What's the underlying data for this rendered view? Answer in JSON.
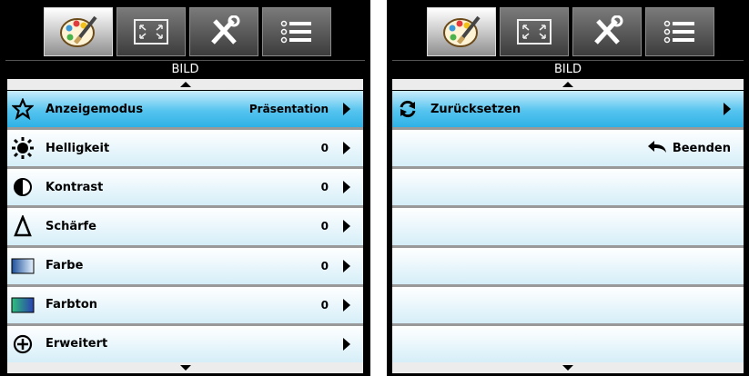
{
  "left_panel": {
    "title": "BILD",
    "rows": [
      {
        "label": "Anzeigemodus",
        "value": "Präsentation",
        "icon": "star-outline-icon",
        "selected": true
      },
      {
        "label": "Helligkeit",
        "value": "0",
        "icon": "brightness-sun-icon"
      },
      {
        "label": "Kontrast",
        "value": "0",
        "icon": "contrast-half-circle-icon"
      },
      {
        "label": "Schärfe",
        "value": "0",
        "icon": "sharpness-triangle-icon"
      },
      {
        "label": "Farbe",
        "value": "0",
        "icon": "color-gradient-icon"
      },
      {
        "label": "Farbton",
        "value": "0",
        "icon": "tint-gradient-icon"
      },
      {
        "label": "Erweitert",
        "value": "",
        "icon": "plus-circle-icon"
      }
    ]
  },
  "right_panel": {
    "title": "BILD",
    "rows": [
      {
        "label": "Zurücksetzen",
        "icon": "reset-arrows-icon",
        "selected": true
      },
      {
        "exit_label": "Beenden",
        "icon": "back-arrow-icon"
      }
    ]
  },
  "tabs": [
    {
      "name": "picture-palette-icon",
      "active": true
    },
    {
      "name": "screen-resize-icon"
    },
    {
      "name": "settings-tools-icon"
    },
    {
      "name": "options-list-icon"
    }
  ]
}
